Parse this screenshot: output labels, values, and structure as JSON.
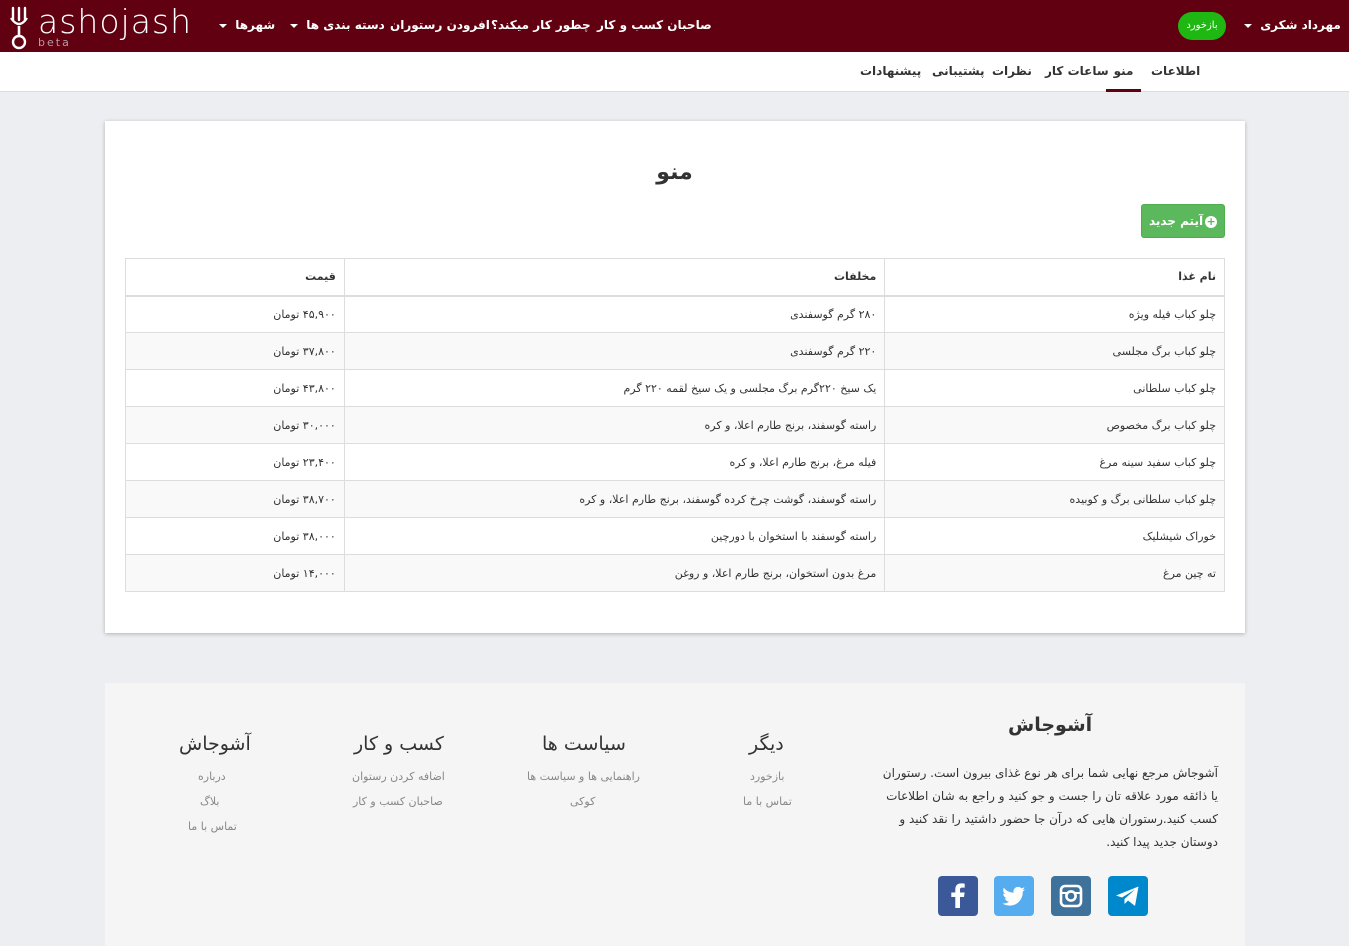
{
  "brand": {
    "name": "ashojash",
    "tag": "beta"
  },
  "topnav": {
    "cities": "شهرها",
    "categories": "دسته بندی ها",
    "add_restaurant": "افرودن رستوران",
    "how_it_works": "چطور کار میکند؟",
    "business_owners": "صاحبان کسب و کار",
    "return_btn": "بازخورد",
    "user": "مهرداد شکری"
  },
  "tabs": [
    "اطلاعات",
    "منو",
    "ساعات کار",
    "نظرات",
    "پشتیبانی",
    "پیشنهادات"
  ],
  "active_tab": "منو",
  "menu": {
    "title": "منو",
    "new_item_label": "آیتم جدید",
    "headers": {
      "name": "نام غذا",
      "ingredients": "مخلفات",
      "price": "قیمت"
    },
    "rows": [
      {
        "name": "چلو کباب فیله ویژه",
        "ingredients": "۲۸۰ گرم گوسفندی",
        "price": "۴۵,۹۰۰ تومان"
      },
      {
        "name": "چلو کباب برگ مجلسی",
        "ingredients": "۲۲۰ گرم گوسفندی",
        "price": "۳۷,۸۰۰ تومان"
      },
      {
        "name": "چلو کباب سلطانی",
        "ingredients": "یک سیخ ۲۲۰گرم برگ مجلسی و یک سیخ لقمه ۲۲۰ گرم",
        "price": "۴۳,۸۰۰ تومان"
      },
      {
        "name": "چلو کباب برگ مخصوص",
        "ingredients": "راسته گوسفند، برنج طارم اعلا، و کره",
        "price": "۳۰,۰۰۰ تومان"
      },
      {
        "name": "چلو کباب سفید سینه مرغ",
        "ingredients": "فیله مرغ، برنج طارم اعلا، و کره",
        "price": "۲۳,۴۰۰ تومان"
      },
      {
        "name": "چلو کباب سلطانی برگ و کوبیده",
        "ingredients": "راسته گوسفند، گوشت چرخ کرده گوسفند، برنج طارم اعلا، و کره",
        "price": "۳۸,۷۰۰ تومان"
      },
      {
        "name": "خوراک شیشلیک",
        "ingredients": "راسته گوسفند با استخوان با دورچین",
        "price": "۳۸,۰۰۰ تومان"
      },
      {
        "name": "ته چین مرغ",
        "ingredients": "مرغ بدون استخوان، برنج طارم اعلا، و روغن",
        "price": "۱۴,۰۰۰ تومان"
      }
    ]
  },
  "footer": {
    "about_title": "آشوجاش",
    "about_text": "آشوجاش مرجع نهایی شما برای هر نوع غذای بیرون است. رستوران یا ذائقه مورد علاقه تان را جست و جو کنید و راجع به شان اطلاعات کسب کنید.رستوران هایی که درآن جا حضور داشتید را نقد کنید و دوستان جدید پیدا کنید.",
    "col_other": {
      "title": "دیگر",
      "links": [
        "بازخورد",
        "تماس با ما"
      ]
    },
    "col_policy": {
      "title": "سیاست ها",
      "links": [
        "راهنمایی ها و سیاست ها",
        "کوکی"
      ]
    },
    "col_business": {
      "title": "کسب و کار",
      "links": [
        "اضافه کردن رستوان",
        "صاحبان کسب و کار"
      ]
    },
    "col_brand": {
      "title": "آشوجاش",
      "links": [
        "درباره",
        "بلاگ",
        "تماس با ما"
      ]
    },
    "social": [
      {
        "icon": "facebook-icon",
        "color": "#3b5998"
      },
      {
        "icon": "twitter-icon",
        "color": "#55acee"
      },
      {
        "icon": "instagram-icon",
        "color": "#3f729b"
      },
      {
        "icon": "telegram-icon",
        "color": "#0088cc"
      }
    ]
  }
}
